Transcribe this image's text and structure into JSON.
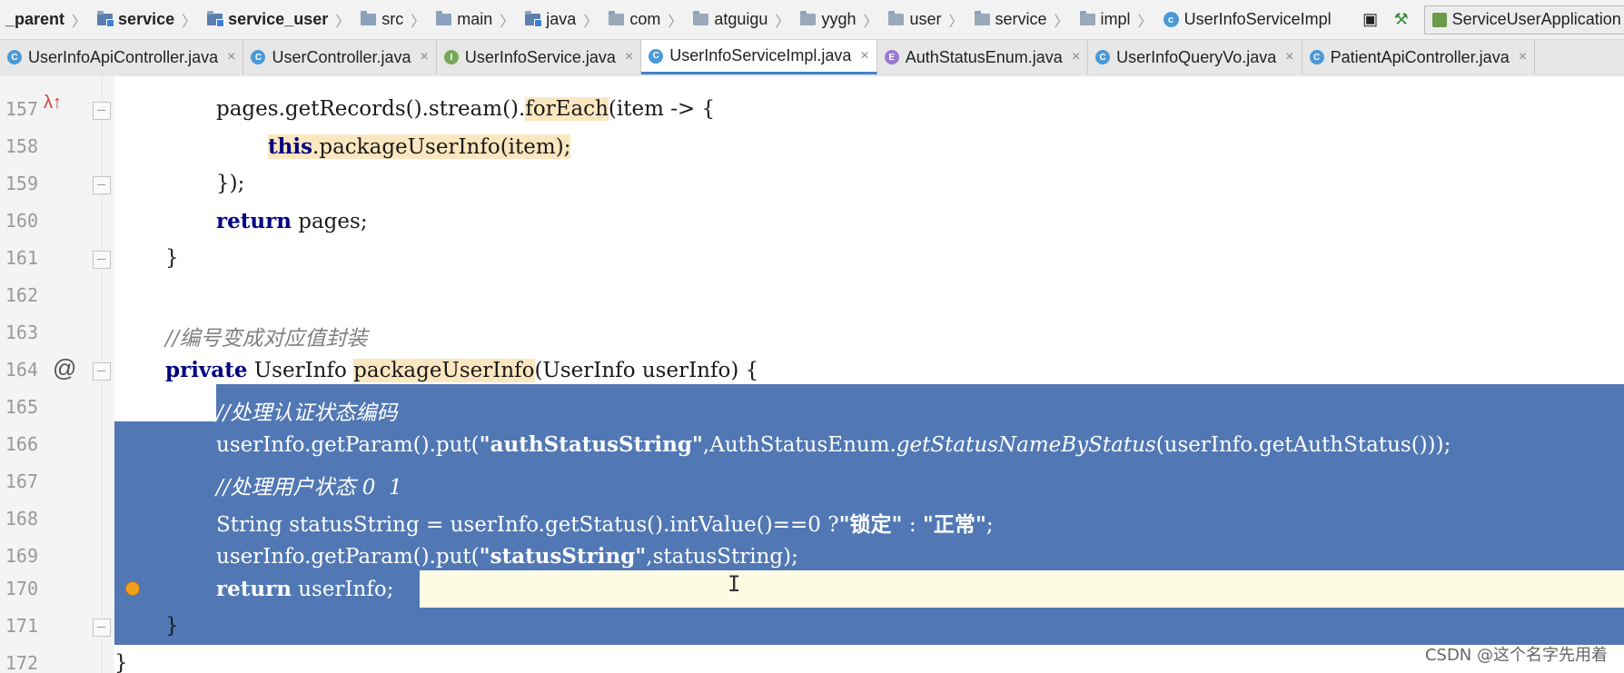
{
  "breadcrumb": {
    "items": [
      {
        "label": "_parent",
        "bold": true
      },
      {
        "label": "service",
        "bold": true
      },
      {
        "label": "service_user",
        "bold": true
      },
      {
        "label": "src"
      },
      {
        "label": "main"
      },
      {
        "label": "java"
      },
      {
        "label": "com"
      },
      {
        "label": "atguigu"
      },
      {
        "label": "yygh"
      },
      {
        "label": "user"
      },
      {
        "label": "service"
      },
      {
        "label": "impl"
      },
      {
        "label": "UserInfoServiceImpl"
      }
    ]
  },
  "toolbar": {
    "run_config": "ServiceUserApplication"
  },
  "tabs": [
    {
      "label": "UserInfoApiController.java",
      "icon": "C"
    },
    {
      "label": "UserController.java",
      "icon": "C"
    },
    {
      "label": "UserInfoService.java",
      "icon": "I"
    },
    {
      "label": "UserInfoServiceImpl.java",
      "icon": "C",
      "active": true
    },
    {
      "label": "AuthStatusEnum.java",
      "icon": "E"
    },
    {
      "label": "UserInfoQueryVo.java",
      "icon": "C"
    },
    {
      "label": "PatientApiController.java",
      "icon": "C"
    }
  ],
  "code": {
    "ln157": "157",
    "ln158": "158",
    "ln159": "159",
    "ln160": "160",
    "ln161": "161",
    "ln162": "162",
    "ln163": "163",
    "ln164": "164",
    "ln165": "165",
    "ln166": "166",
    "ln167": "167",
    "ln168": "168",
    "ln169": "169",
    "ln170": "170",
    "ln171": "171",
    "ln172": "172",
    "l157_a": "pages.getRecords().stream().",
    "l157_b": "forEach",
    "l157_c": "(item -> {",
    "l158_a": "this",
    "l158_b": ".packageUserInfo(item)",
    "l158_c": ";",
    "l159": "});",
    "l160_kw": "return",
    "l160_rest": " pages;",
    "l161": "}",
    "l163": "//编号变成对应值封装",
    "l164_kw": "private",
    "l164_a": " UserInfo ",
    "l164_b": "packageUserInfo",
    "l164_c": "(UserInfo userInfo) {",
    "l165": "//处理认证状态编码",
    "l166_a": "userInfo.getParam().put(",
    "l166_str": "\"authStatusString\"",
    "l166_b": ",AuthStatusEnum.",
    "l166_it": "getStatusNameByStatus",
    "l166_c": "(userInfo.getAuthStatus()));",
    "l167": "//处理用户状态 0  1",
    "l168_a": "String statusString = userInfo.getStatus().intValue()==0 ?",
    "l168_s1": "\"锁定\"",
    "l168_b": " : ",
    "l168_s2": "\"正常\"",
    "l168_c": ";",
    "l169_a": "userInfo.getParam().put(",
    "l169_str": "\"statusString\"",
    "l169_b": ",statusString);",
    "l170_kw": "return",
    "l170_a": " userInfo",
    "l170_b": ";",
    "l171": "}",
    "l172": "}"
  },
  "watermark": "CSDN @这个名字先用着",
  "colors": {
    "selection": "#5178b4",
    "keyword": "#000080",
    "comment": "#808080",
    "string": "#008000",
    "usage_highlight": "#fbe7bf"
  }
}
